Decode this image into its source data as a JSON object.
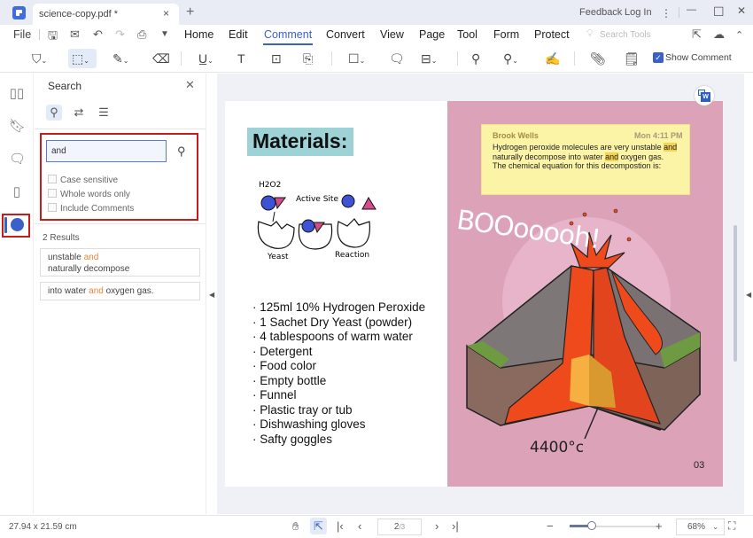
{
  "titlebar": {
    "tab_title": "science-copy.pdf *",
    "tab_close": "×",
    "new_tab": "+",
    "feedback": "Feedback",
    "login": "Log In",
    "more": "⋮",
    "minimize": "—",
    "maximize": "☐",
    "close": "✕"
  },
  "menu": {
    "file": "File",
    "items": [
      "Home",
      "Edit",
      "Comment",
      "Convert",
      "View",
      "Page",
      "Tool",
      "Form",
      "Protect"
    ],
    "active": "Comment",
    "search_tools_placeholder": "Search Tools"
  },
  "toolbar": {
    "show_comment_label": "Show Comment",
    "show_comment_checked": true
  },
  "search_panel": {
    "title": "Search",
    "query": "and",
    "options": [
      {
        "label": "Case sensitive",
        "checked": false
      },
      {
        "label": "Whole words only",
        "checked": false
      },
      {
        "label": "Include Comments",
        "checked": false
      }
    ],
    "results_count": "2 Results",
    "results": [
      {
        "before": "unstable ",
        "match": "and",
        "after": "",
        "line2": "naturally decompose"
      },
      {
        "before": "into water ",
        "match": "and",
        "after": " oxygen gas.",
        "line2": ""
      }
    ]
  },
  "document": {
    "left_page": {
      "title": "Materials:",
      "diagram_labels": [
        "H2O2",
        "Active Site",
        "Yeast",
        "Reaction"
      ],
      "list": [
        "125ml 10% Hydrogen Peroxide",
        "1 Sachet Dry Yeast (powder)",
        "4 tablespoons of warm water",
        "Detergent",
        "Food color",
        "Empty bottle",
        "Funnel",
        "Plastic tray or tub",
        "Dishwashing gloves",
        "Safty goggles"
      ]
    },
    "right_page": {
      "note": {
        "author": "Brook Wells",
        "time": "Mon 4:11 PM",
        "line1_before": "Hydrogen peroxide molecules are very unstable ",
        "line1_match": "and",
        "line2_before": "naturally decompose into water ",
        "line2_match": "and",
        "line2_after": " oxygen gas.",
        "line3": "The chemical equation for this decompostion is:"
      },
      "boom_text": "BOOooooh!",
      "temperature": "4400°c",
      "page_number": "03"
    }
  },
  "statusbar": {
    "page_size": "27.94 x 21.59 cm",
    "current_page": "2",
    "total_pages": "/3",
    "zoom": "68%",
    "zoom_fraction": 0.25
  },
  "colors": {
    "accent": "#3b61c8",
    "highlight_box": "#c81b1b",
    "match": "#e8863a",
    "note_bg": "#fbf3a6",
    "page_pink": "#dca2b8"
  }
}
